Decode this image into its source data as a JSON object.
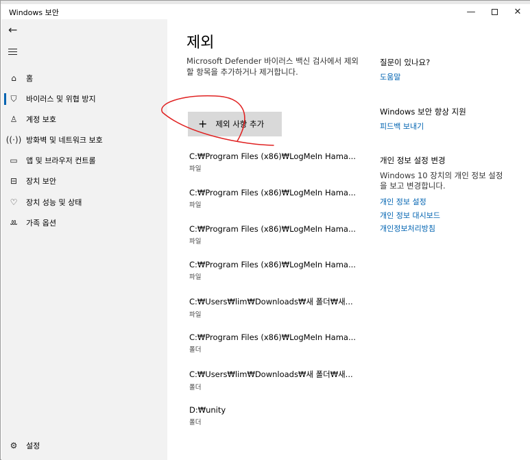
{
  "window": {
    "title": "Windows 보안"
  },
  "sidebar": {
    "items": [
      {
        "label": "홈",
        "icon": "home-icon",
        "glyph": "⌂"
      },
      {
        "label": "바이러스 및 위협 방지",
        "icon": "shield-icon",
        "glyph": "⛉",
        "active": true
      },
      {
        "label": "계정 보호",
        "icon": "person-icon",
        "glyph": "♙"
      },
      {
        "label": "방화벽 및 네트워크 보호",
        "icon": "wifi-antenna-icon",
        "glyph": "((·))"
      },
      {
        "label": "앱 및 브라우저 컨트롤",
        "icon": "app-window-icon",
        "glyph": "▭"
      },
      {
        "label": "장치 보안",
        "icon": "laptop-icon",
        "glyph": "⊟"
      },
      {
        "label": "장치 성능 및 상태",
        "icon": "heart-pulse-icon",
        "glyph": "♡"
      },
      {
        "label": "가족 옵션",
        "icon": "family-icon",
        "glyph": "ꔛ"
      }
    ],
    "settings_label": "설정"
  },
  "main": {
    "title": "제외",
    "description": "Microsoft Defender 바이러스 백신 검사에서 제외할 항목을 추가하거나 제거합니다.",
    "add_button": "제외 사항 추가",
    "exclusions": [
      {
        "path": "C:₩Program Files (x86)₩LogMeIn Hama...",
        "type": "파일"
      },
      {
        "path": "C:₩Program Files (x86)₩LogMeIn Hama...",
        "type": "파일"
      },
      {
        "path": "C:₩Program Files (x86)₩LogMeIn Hama...",
        "type": "파일"
      },
      {
        "path": "C:₩Program Files (x86)₩LogMeIn Hama...",
        "type": "파일"
      },
      {
        "path": "C:₩Users₩lim₩Downloads₩새 폴더₩새...",
        "type": "파일"
      },
      {
        "path": "C:₩Program Files (x86)₩LogMeIn Hama...",
        "type": "폴더"
      },
      {
        "path": "C:₩Users₩lim₩Downloads₩새 폴더₩새...",
        "type": "폴더"
      },
      {
        "path": "D:₩unity",
        "type": "폴더"
      }
    ]
  },
  "right": {
    "question": {
      "heading": "질문이 있나요?",
      "link": "도움말"
    },
    "improve": {
      "heading": "Windows 보안 향상 지원",
      "link": "피드백 보내기"
    },
    "privacy": {
      "heading": "개인 정보 설정 변경",
      "text": "Windows 10 장치의 개인 정보 설정을 보고 변경합니다.",
      "links": [
        "개인 정보 설정",
        "개인 정보 대시보드",
        "개인정보처리방침"
      ]
    }
  },
  "colors": {
    "accent": "#0063b1",
    "sidebar_bg": "#f2f2f2",
    "button_bg": "#d9d9d9",
    "annotation": "#e02020"
  }
}
